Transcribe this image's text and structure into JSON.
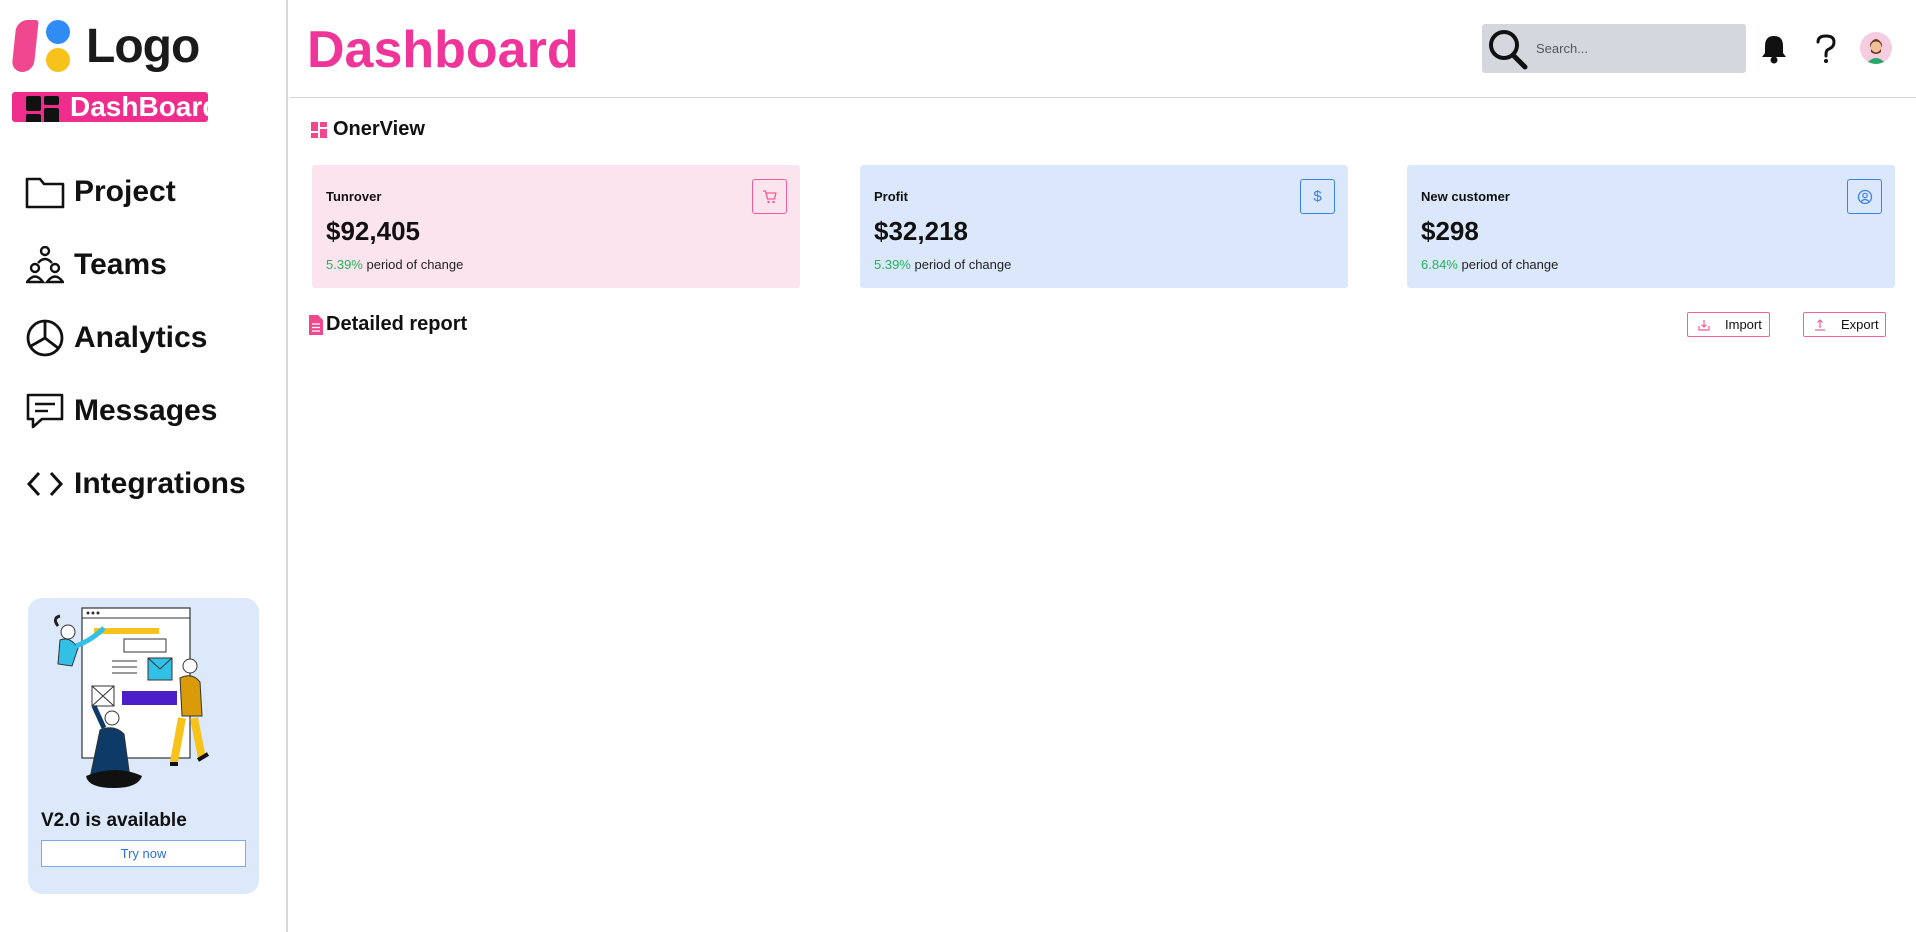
{
  "brand": {
    "logo_text": "Logo"
  },
  "sidebar": {
    "active_item": {
      "label": "DashBoard",
      "icon": "dashboard-grid-icon"
    },
    "items": [
      {
        "label": "Project",
        "icon": "folder-icon"
      },
      {
        "label": "Teams",
        "icon": "teams-icon"
      },
      {
        "label": "Analytics",
        "icon": "pie-chart-icon"
      },
      {
        "label": "Messages",
        "icon": "message-icon"
      },
      {
        "label": "Integrations",
        "icon": "code-icon"
      }
    ],
    "promo": {
      "title": "V2.0 is available",
      "button": "Try now"
    }
  },
  "header": {
    "title": "Dashboard",
    "search": {
      "placeholder": "Search..."
    },
    "icons": [
      "bell-icon",
      "help-icon",
      "avatar"
    ]
  },
  "overview": {
    "title": "OnerView",
    "cards": [
      {
        "label": "Tunrover",
        "value": "$92,405",
        "change_pct": "5.39%",
        "change_text": "period of change",
        "icon": "cart-icon",
        "theme": "pink"
      },
      {
        "label": "Profit",
        "value": "$32,218",
        "change_pct": "5.39%",
        "change_text": "period of change",
        "icon": "dollar-icon",
        "theme": "blue"
      },
      {
        "label": "New customer",
        "value": "$298",
        "change_pct": "6.84%",
        "change_text": "period of change",
        "icon": "user-circle-icon",
        "theme": "blue"
      }
    ]
  },
  "report": {
    "title": "Detailed report",
    "import_label": "Import",
    "export_label": "Export"
  },
  "colors": {
    "accent_pink": "#ee2d8c",
    "title_pink": "#f0359a",
    "positive_green": "#23b35a",
    "card_pink_bg": "#fce4ef",
    "card_blue_bg": "#dbe8fb"
  }
}
